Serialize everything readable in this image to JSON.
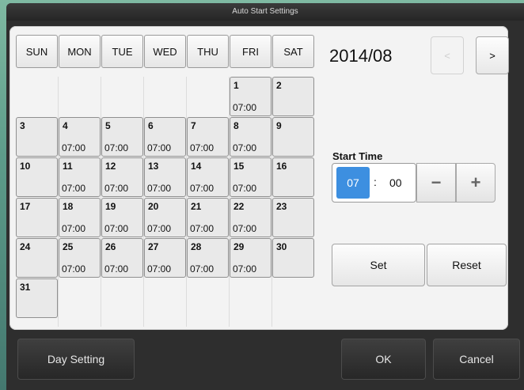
{
  "window": {
    "title": "Auto Start Settings"
  },
  "calendar": {
    "weekdays": [
      "SUN",
      "MON",
      "TUE",
      "WED",
      "THU",
      "FRI",
      "SAT"
    ],
    "month_label": "2014/08",
    "prev_label": "<",
    "next_label": ">",
    "days": [
      {
        "day": "1",
        "time": "07:00"
      },
      {
        "day": "2",
        "time": ""
      },
      {
        "day": "3",
        "time": ""
      },
      {
        "day": "4",
        "time": "07:00"
      },
      {
        "day": "5",
        "time": "07:00"
      },
      {
        "day": "6",
        "time": "07:00"
      },
      {
        "day": "7",
        "time": "07:00"
      },
      {
        "day": "8",
        "time": "07:00"
      },
      {
        "day": "9",
        "time": ""
      },
      {
        "day": "10",
        "time": ""
      },
      {
        "day": "11",
        "time": "07:00"
      },
      {
        "day": "12",
        "time": "07:00"
      },
      {
        "day": "13",
        "time": "07:00"
      },
      {
        "day": "14",
        "time": "07:00"
      },
      {
        "day": "15",
        "time": "07:00"
      },
      {
        "day": "16",
        "time": ""
      },
      {
        "day": "17",
        "time": ""
      },
      {
        "day": "18",
        "time": "07:00"
      },
      {
        "day": "19",
        "time": "07:00"
      },
      {
        "day": "20",
        "time": "07:00"
      },
      {
        "day": "21",
        "time": "07:00"
      },
      {
        "day": "22",
        "time": "07:00"
      },
      {
        "day": "23",
        "time": ""
      },
      {
        "day": "24",
        "time": ""
      },
      {
        "day": "25",
        "time": "07:00"
      },
      {
        "day": "26",
        "time": "07:00"
      },
      {
        "day": "27",
        "time": "07:00"
      },
      {
        "day": "28",
        "time": "07:00"
      },
      {
        "day": "29",
        "time": "07:00"
      },
      {
        "day": "30",
        "time": ""
      },
      {
        "day": "31",
        "time": ""
      }
    ]
  },
  "start_time": {
    "label": "Start Time",
    "hour": "07",
    "separator": ":",
    "minute": "00",
    "minus_label": "−",
    "plus_label": "+"
  },
  "actions": {
    "set_label": "Set",
    "reset_label": "Reset"
  },
  "footer": {
    "day_setting_label": "Day Setting",
    "ok_label": "OK",
    "cancel_label": "Cancel"
  }
}
